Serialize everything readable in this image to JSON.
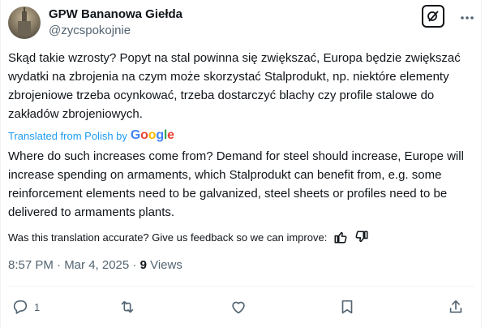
{
  "author": {
    "display_name": "GPW Bananowa Giełda",
    "handle": "@zycspokojnie"
  },
  "post": {
    "original_text": "Skąd takie wzrosty? Popyt na stal powinna się zwiększać, Europa będzie zwiększać wydatki na zbrojenia na czym może skorzystać Stalprodukt, np. niektóre elementy zbrojeniowe trzeba ocynkować, trzeba dostarczyć blachy czy profile stalowe do zakładów zbrojeniowych.",
    "translated_by_label": "Translated from Polish by",
    "translation_provider": [
      "G",
      "o",
      "o",
      "g",
      "l",
      "e"
    ],
    "translated_text": "Where do such increases come from? Demand for steel should increase, Europe will increase spending on armaments, which Stalprodukt can benefit from, e.g. some reinforcement elements need to be galvanized, steel sheets or profiles need to be delivered to armaments plants.",
    "feedback_prompt": "Was this translation accurate? Give us feedback so we can improve:",
    "timestamp": "8:57 PM · Mar 4, 2025 · ",
    "views_count": "9",
    "views_label": " Views"
  },
  "actions": {
    "reply_count": "1",
    "retweet_count": "",
    "like_count": "",
    "icons": [
      "reply-icon",
      "retweet-icon",
      "like-icon",
      "bookmark-icon",
      "share-icon"
    ]
  },
  "colors": {
    "link": "#1d9bf0",
    "secondary_text": "#536471",
    "primary_text": "#0f1419"
  }
}
